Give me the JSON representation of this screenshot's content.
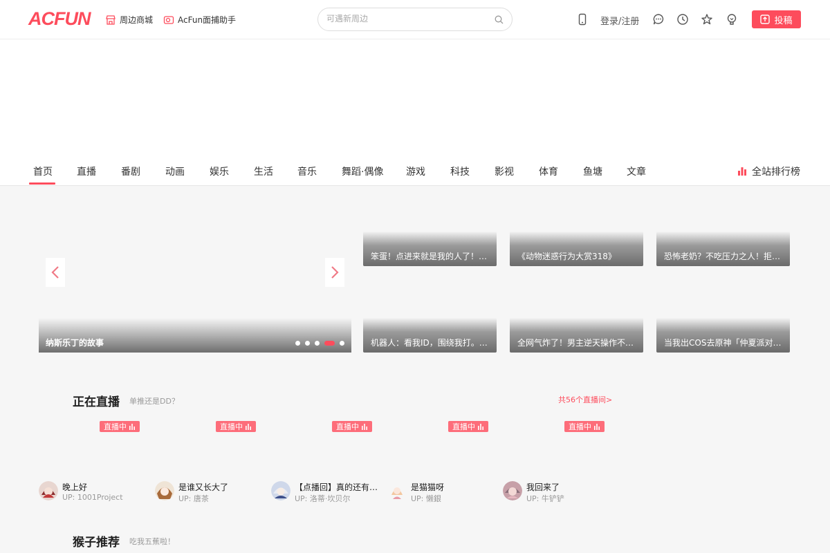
{
  "header": {
    "logo": "ACFUN",
    "links": [
      "周边商城",
      "AcFun面捕助手"
    ],
    "search_placeholder": "可遇新周边",
    "login": "登录/注册",
    "upload": "投稿"
  },
  "nav": {
    "items": [
      "首页",
      "直播",
      "番剧",
      "动画",
      "娱乐",
      "生活",
      "音乐",
      "舞蹈·偶像",
      "游戏",
      "科技",
      "影视",
      "体育",
      "鱼塘",
      "文章"
    ],
    "rank": "全站排行榜"
  },
  "slider": {
    "title": "纳斯乐丁的故事"
  },
  "cards": [
    "笨蛋！点进来就是我的人了！『...",
    "《动物迷惑行为大赏318》",
    "恐怖老奶？不吃压力之人！拒绝...",
    "机器人：看我ID，围绕我打。紧...",
    "全网气炸了！男主逆天操作不像...",
    "当我出COS去原神「仲夏派对」..."
  ],
  "live": {
    "title": "正在直播",
    "subtitle": "单推还是DD？",
    "more": "共56个直播间>",
    "badge": "直播中",
    "items": [
      {
        "title": "晚上好",
        "up": "UP:  1001Project"
      },
      {
        "title": "是谁又长大了",
        "up": "UP:  唐茶"
      },
      {
        "title": "【点播回】真的还有瓦...",
        "up": "UP:  洛蒂·坎贝尔"
      },
      {
        "title": "是猫猫呀",
        "up": "UP:  懒銀"
      },
      {
        "title": "我回来了",
        "up": "UP:  牛铲铲"
      }
    ]
  },
  "recommend": {
    "title": "猴子推荐",
    "subtitle": "吃我五蕉啦！"
  },
  "colors": {
    "accent": "#fd4c5c"
  }
}
